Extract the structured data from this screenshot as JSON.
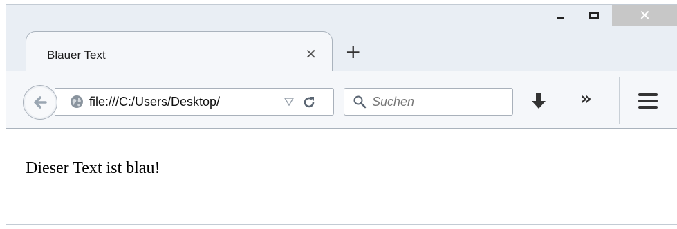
{
  "window_controls": {
    "minimize": "_",
    "maximize": "□",
    "close": "✕"
  },
  "tab": {
    "title": "Blauer Text",
    "close_glyph": "✕"
  },
  "new_tab_glyph": "+",
  "navigation": {
    "url": "file:///C:/Users/Desktop/"
  },
  "search": {
    "placeholder": "Suchen",
    "value": ""
  },
  "toolbar": {
    "overflow_glyph": "»"
  },
  "page": {
    "text": "Dieser Text ist blau!"
  },
  "icons": {
    "back": "back-arrow-icon",
    "globe": "globe-icon",
    "dropdown": "dropdown-triangle-icon",
    "reload": "reload-icon",
    "search": "magnifier-icon",
    "download": "download-arrow-icon",
    "menu": "hamburger-menu-icon"
  },
  "colors": {
    "chrome_bg": "#e9eef4",
    "toolbar_bg": "#f5f7fa",
    "close_button_bg": "#c7c7c7",
    "back_arrow": "#9aa6b2"
  }
}
